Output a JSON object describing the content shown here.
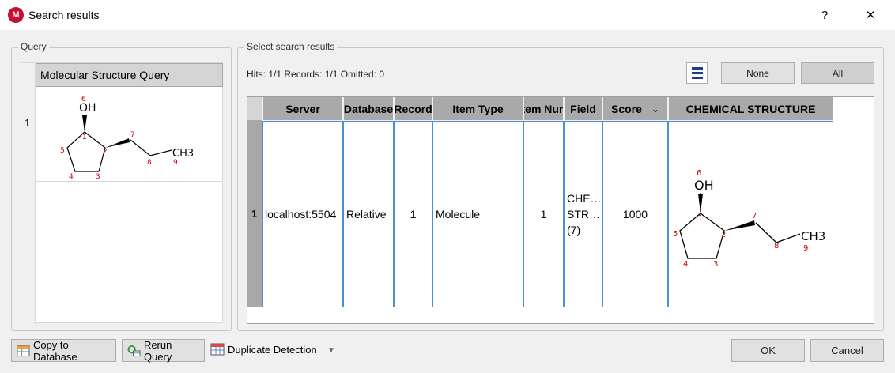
{
  "window": {
    "title": "Search results",
    "help_label": "?",
    "close_label": "✕",
    "icon_letter": "M"
  },
  "query": {
    "group_label": "Query",
    "header": "Molecular Structure Query",
    "row_number": "1",
    "structure": {
      "atoms": [
        "OH",
        "6",
        "1",
        "2",
        "3",
        "4",
        "5",
        "7",
        "8",
        "9",
        "CH3"
      ]
    }
  },
  "results": {
    "group_label": "Select search results",
    "hits_text": "Hits: 1/1 Records: 1/1  Omitted: 0",
    "none_label": "None",
    "all_label": "All",
    "columns": [
      "Server",
      "Database",
      "Record",
      "Item Type",
      "Item Num",
      "Field",
      "Score",
      "CHEMICAL STRUCTURE"
    ],
    "sort_indicator": "⌄",
    "row": {
      "number": "1",
      "server": "localhost:5504",
      "database": "Relative",
      "record": "1",
      "item_type": "Molecule",
      "item_num": "1",
      "field_line1": "CHE…",
      "field_line2": "STR…",
      "field_line3": "(7)",
      "score": "1000"
    }
  },
  "footer": {
    "copy_label": "Copy to Database",
    "rerun_label": "Rerun Query",
    "duplicate_label": "Duplicate Detection",
    "ok_label": "OK",
    "cancel_label": "Cancel"
  }
}
